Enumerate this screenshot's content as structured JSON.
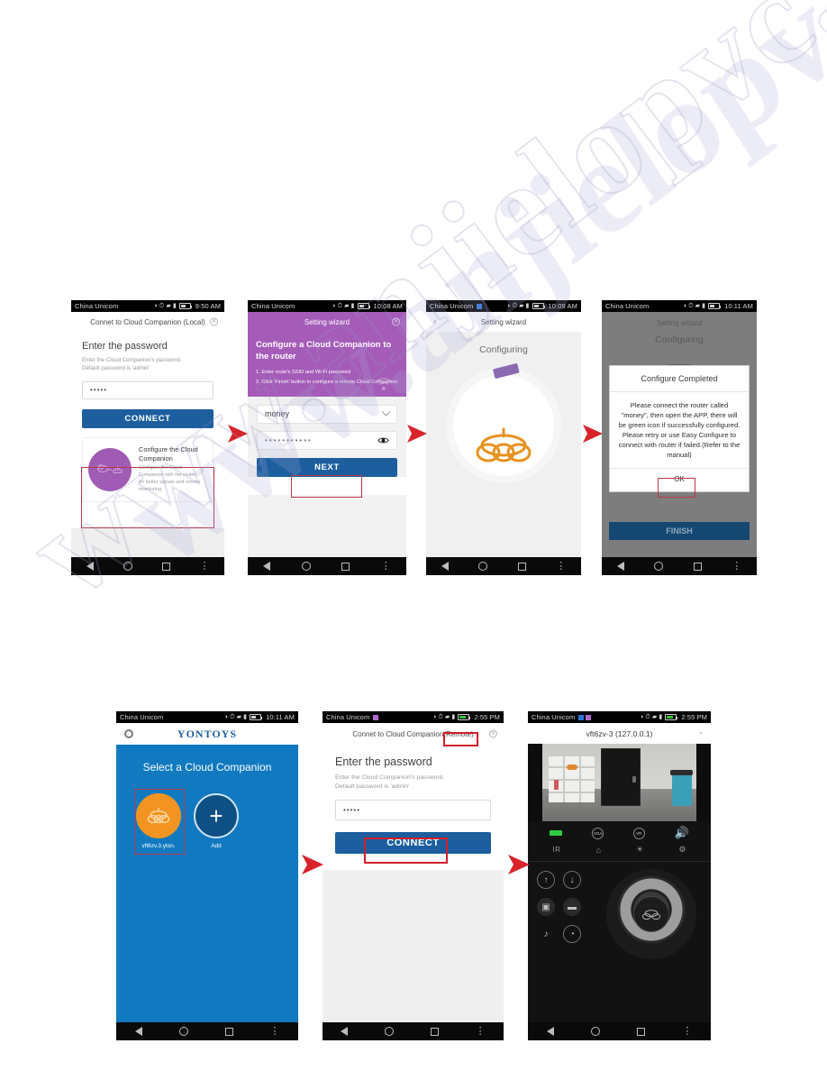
{
  "watermark": {
    "line1": "www.anjielopvc.com"
  },
  "phones": [
    {
      "id": "phone-local-password",
      "status": {
        "carrier": "China Unicom",
        "time": "9:50 AM"
      },
      "appbar_title": "Connet to Cloud Companion (Local)",
      "heading": "Enter the password",
      "sub_line1": "Enter the Cloud Companion's password.",
      "sub_line2": "Default password is 'admin'",
      "password_value": "•••••",
      "connect_label": "CONNECT",
      "card": {
        "title": "Configure the Cloud Companion",
        "desc": "Configure the Cloud Companion with the router for better signals and remote monitoring"
      }
    },
    {
      "id": "phone-setting-wizard",
      "status": {
        "carrier": "China Unicom",
        "time": "10:08 AM"
      },
      "appbar_title": "Setting wizard",
      "hero_title": "Configure a Cloud Companion to the router",
      "step1": "1. Enter route's SSID and Wi-Fi password",
      "step2": "2. Click 'Finish' button to configure a remote Cloud Companion",
      "ssid_value": "money",
      "wifi_password": "•••••••••••",
      "next_label": "NEXT"
    },
    {
      "id": "phone-configuring",
      "status": {
        "carrier": "China Unicom",
        "time": "10:09 AM"
      },
      "appbar_title": "Setting wizard",
      "configuring_label": "Configuring"
    },
    {
      "id": "phone-configure-completed",
      "status": {
        "carrier": "China Unicom",
        "time": "10:11 AM"
      },
      "appbar_title": "Setting wizard",
      "configuring_label": "Configuring",
      "dialog_title": "Configure Completed",
      "dialog_message": "Please connect the router called \"money\", then open the APP, there will be green icon if successfully configured. Please retry or use Easy Configure to connect with router if failed.(Refer to the manual)",
      "dialog_ok": "OK",
      "finish_label": "FINISH"
    },
    {
      "id": "phone-select-companion",
      "status": {
        "carrier": "China Unicom",
        "time": "10:11 AM"
      },
      "logo": "YONTOYS",
      "heading": "Select a Cloud Companion",
      "device_label": "vft6zv.3.yton.",
      "add_label": "Add"
    },
    {
      "id": "phone-remote-password",
      "status": {
        "carrier": "China Unicom",
        "time": "2:55 PM"
      },
      "appbar_title_prefix": "Connet to Cloud Companion ",
      "appbar_title_highlight": "(Remote)",
      "heading": "Enter the password",
      "sub_line1": "Enter the Cloud Companion's password.",
      "sub_line2": "Default password is 'admin'",
      "password_value": "•••••",
      "connect_label": "CONNECT"
    },
    {
      "id": "phone-live-view",
      "status": {
        "carrier": "China Unicom",
        "time": "2:55 PM"
      },
      "title": "vft6zv-3 (127.0.0.1)",
      "cast_icon": "cast-icon",
      "controls_row1": [
        "battery-pill",
        "VGA",
        "VR",
        "speaker-icon"
      ],
      "controls_row2": [
        "IR",
        "snapshot-lock-icon",
        "brightness-icon",
        "settings-icon"
      ],
      "labels": {
        "vga": "VGA",
        "vr": "VR",
        "ir": "IR"
      }
    }
  ],
  "colors": {
    "accent_blue": "#1c5e9e",
    "purple": "#a45cb8",
    "orange": "#f39422",
    "yontoys_blue": "#1179c0",
    "highlight_red": "#b93a4b",
    "arrow_red": "#d8232a",
    "green": "#2ecc40"
  }
}
